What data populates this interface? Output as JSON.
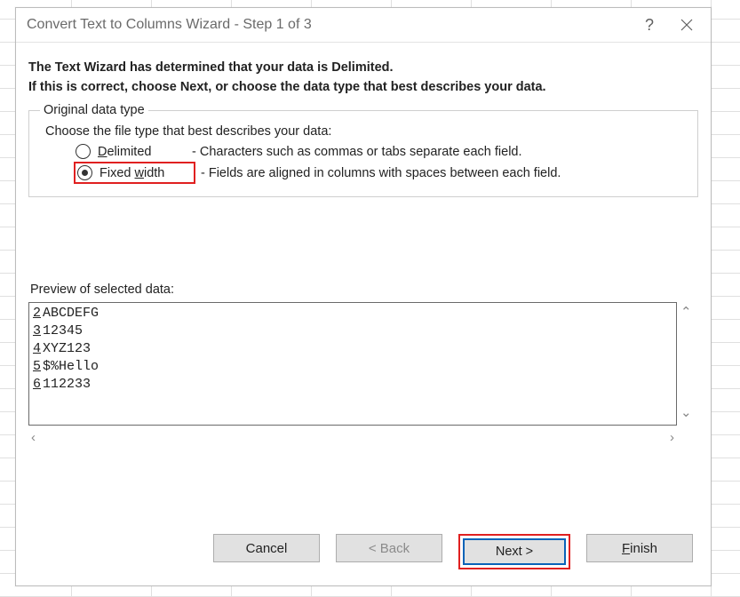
{
  "titlebar": {
    "title": "Convert Text to Columns Wizard - Step 1 of 3"
  },
  "intro": {
    "line1": "The Text Wizard has determined that your data is Delimited.",
    "line2": "If this is correct, choose Next, or choose the data type that best describes your data."
  },
  "group": {
    "legend": "Original data type",
    "choose": "Choose the file type that best describes your data:",
    "delimited": {
      "prefix": "D",
      "rest": "elimited",
      "desc": "- Characters such as commas or tabs separate each field.",
      "selected": false
    },
    "fixed": {
      "prefix": "Fixed ",
      "ul": "w",
      "rest": "idth",
      "desc": "- Fields are aligned in columns with spaces between each field.",
      "selected": true
    }
  },
  "preview": {
    "label": "Preview of selected data:",
    "rows": [
      {
        "n": "2",
        "t": "ABCDEFG"
      },
      {
        "n": "3",
        "t": "12345"
      },
      {
        "n": "4",
        "t": "XYZ123"
      },
      {
        "n": "5",
        "t": "$%Hello"
      },
      {
        "n": "6",
        "t": "112233"
      }
    ]
  },
  "buttons": {
    "cancel": "Cancel",
    "back": "< Back",
    "next_ul": "N",
    "next_rest": "ext >",
    "finish_ul": "F",
    "finish_rest": "inish"
  }
}
